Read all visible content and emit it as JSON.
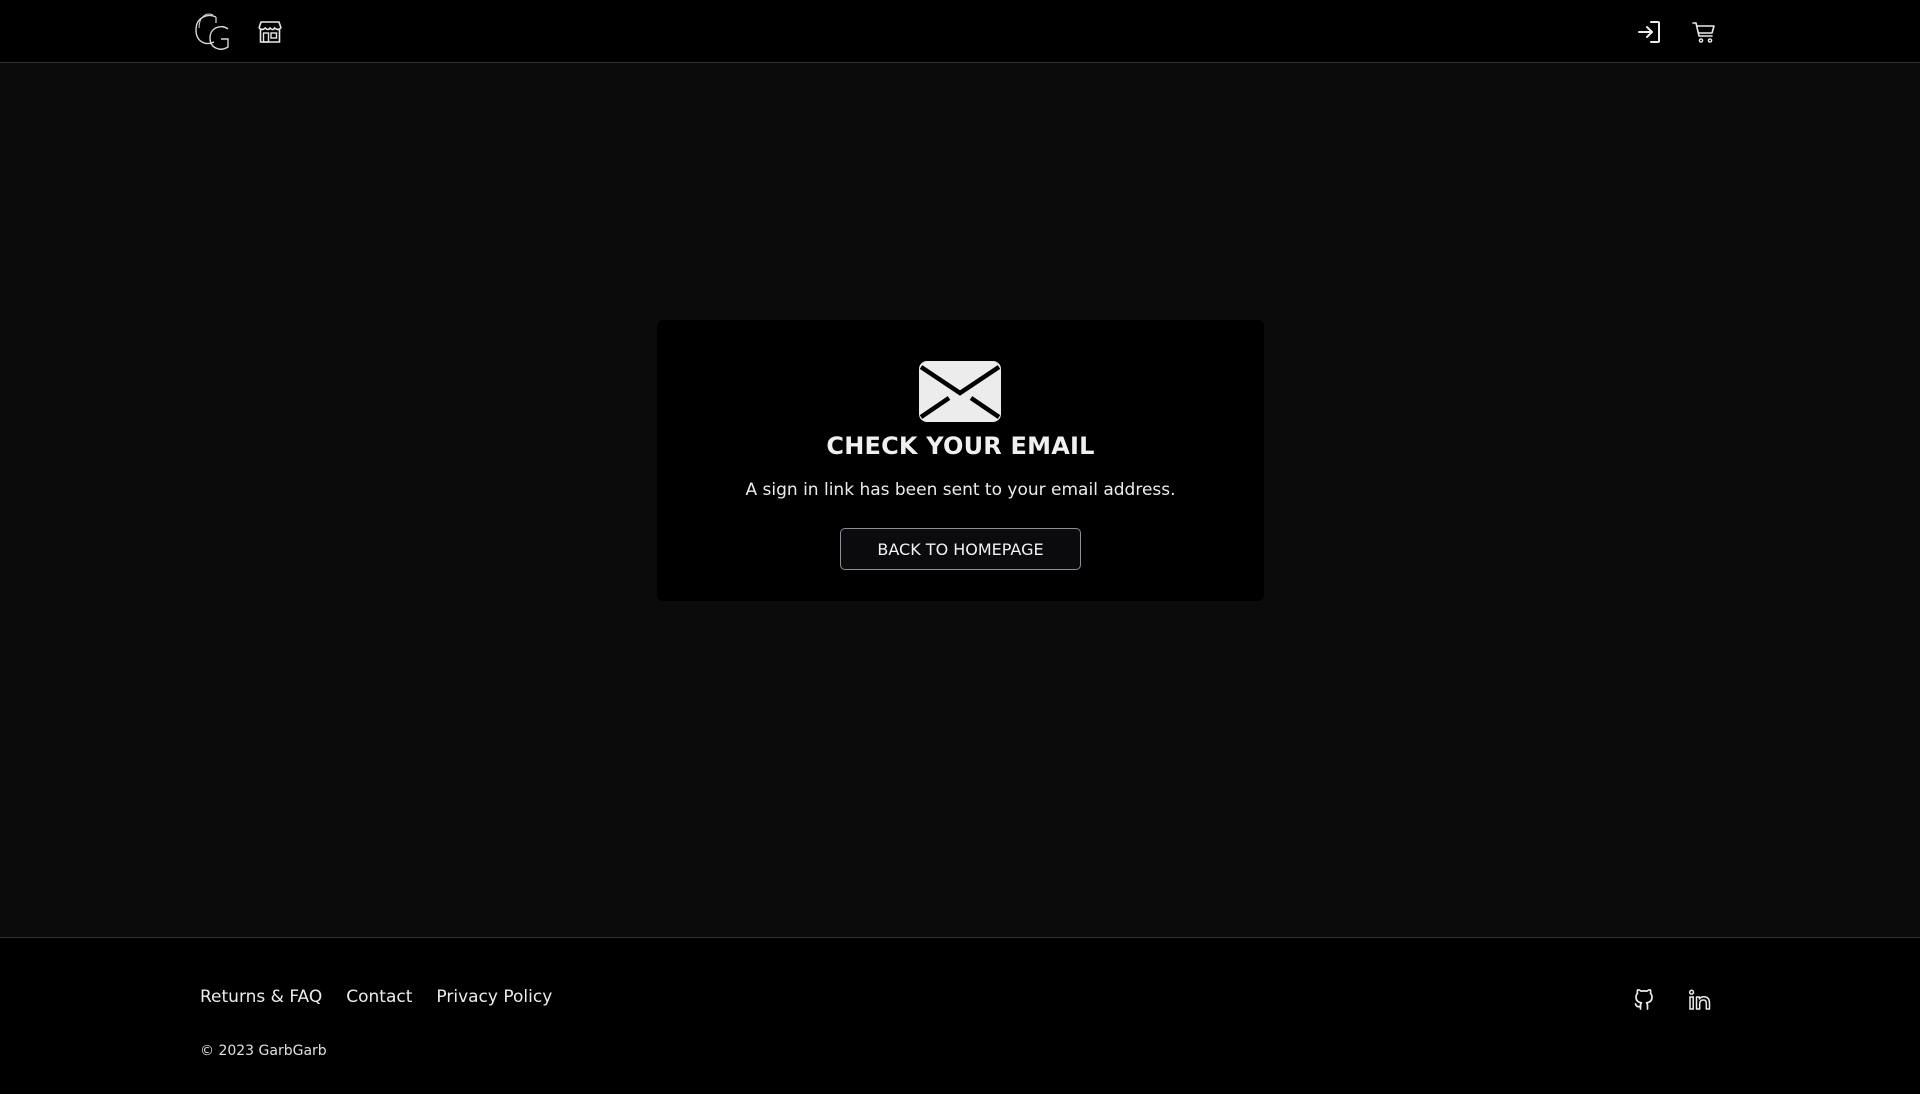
{
  "header": {
    "logo_icon": "gg-monogram-logo",
    "store_icon": "storefront-icon",
    "signin_icon": "sign-in-icon",
    "cart_icon": "shopping-cart-icon"
  },
  "card": {
    "icon": "envelope-icon",
    "title": "CHECK YOUR EMAIL",
    "description": "A sign in link has been sent to your email address.",
    "button_label": "BACK TO HOMEPAGE"
  },
  "footer": {
    "links": [
      "Returns & FAQ",
      "Contact",
      "Privacy Policy"
    ],
    "copyright": "© 2023 GarbGarb",
    "social_icons": [
      "github-icon",
      "linkedin-icon"
    ]
  },
  "colors": {
    "page_background": "#0b0b0b",
    "bar_background": "#000000",
    "text": "#ececec",
    "button_border": "#8a8f9a"
  }
}
